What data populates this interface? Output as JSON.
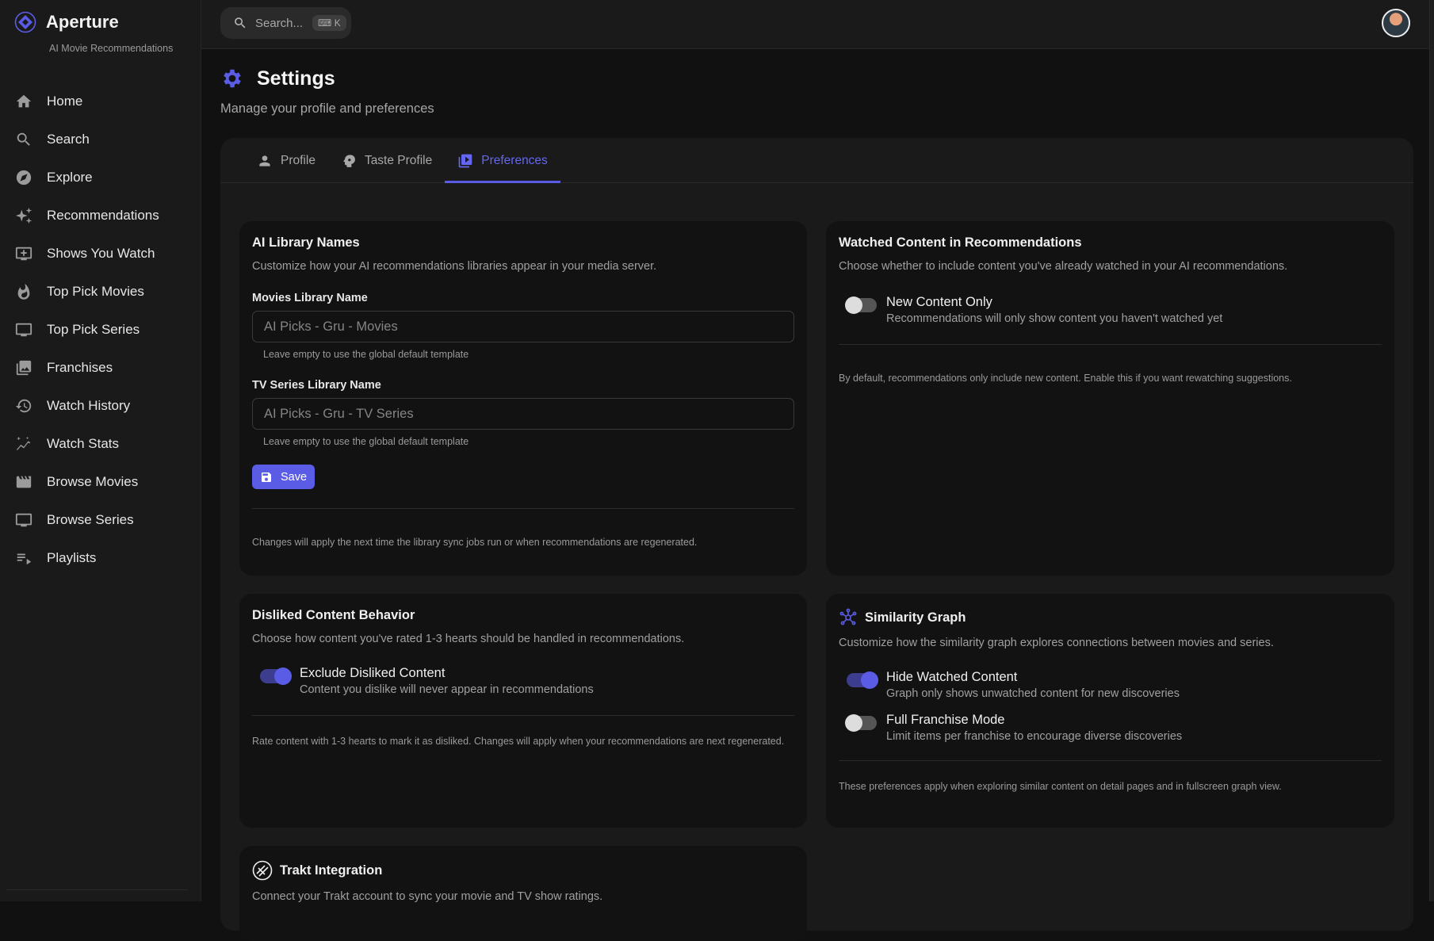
{
  "brand": {
    "name": "Aperture",
    "tagline": "AI Movie Recommendations"
  },
  "sidebar": {
    "items": [
      {
        "label": "Home",
        "icon": "home-icon"
      },
      {
        "label": "Search",
        "icon": "search-icon"
      },
      {
        "label": "Explore",
        "icon": "compass-icon"
      },
      {
        "label": "Recommendations",
        "icon": "sparkles-icon"
      },
      {
        "label": "Shows You Watch",
        "icon": "tv-add-icon"
      },
      {
        "label": "Top Pick Movies",
        "icon": "fire-icon"
      },
      {
        "label": "Top Pick Series",
        "icon": "tv-icon"
      },
      {
        "label": "Franchises",
        "icon": "photo-library-icon"
      },
      {
        "label": "Watch History",
        "icon": "history-icon"
      },
      {
        "label": "Watch Stats",
        "icon": "chart-icon"
      },
      {
        "label": "Browse Movies",
        "icon": "clapperboard-icon"
      },
      {
        "label": "Browse Series",
        "icon": "tv-icon"
      },
      {
        "label": "Playlists",
        "icon": "playlist-icon"
      }
    ]
  },
  "topbar": {
    "search_placeholder": "Search...",
    "shortcut": "K"
  },
  "page": {
    "title": "Settings",
    "subtitle": "Manage your profile and preferences"
  },
  "tabs": [
    {
      "label": "Profile"
    },
    {
      "label": "Taste Profile"
    },
    {
      "label": "Preferences",
      "active": true
    }
  ],
  "library": {
    "title": "AI Library Names",
    "desc": "Customize how your AI recommendations libraries appear in your media server.",
    "movies_label": "Movies Library Name",
    "movies_placeholder": "AI Picks - Gru - Movies",
    "series_label": "TV Series Library Name",
    "series_placeholder": "AI Picks - Gru - TV Series",
    "hint": "Leave empty to use the global default template",
    "save": "Save",
    "footer": "Changes will apply the next time the library sync jobs run or when recommendations are regenerated."
  },
  "watched": {
    "title": "Watched Content in Recommendations",
    "desc": "Choose whether to include content you've already watched in your AI recommendations.",
    "toggle_title": "New Content Only",
    "toggle_sub": "Recommendations will only show content you haven't watched yet",
    "toggle_on": false,
    "footer": "By default, recommendations only include new content. Enable this if you want rewatching suggestions."
  },
  "disliked": {
    "title": "Disliked Content Behavior",
    "desc": "Choose how content you've rated 1-3 hearts should be handled in recommendations.",
    "toggle_title": "Exclude Disliked Content",
    "toggle_sub": "Content you dislike will never appear in recommendations",
    "toggle_on": true,
    "footer": "Rate content with 1-3 hearts to mark it as disliked. Changes will apply when your recommendations are next regenerated."
  },
  "graph": {
    "title": "Similarity Graph",
    "desc": "Customize how the similarity graph explores connections between movies and series.",
    "t1_title": "Hide Watched Content",
    "t1_sub": "Graph only shows unwatched content for new discoveries",
    "t1_on": true,
    "t2_title": "Full Franchise Mode",
    "t2_sub": "Limit items per franchise to encourage diverse discoveries",
    "t2_on": false,
    "footer": "These preferences apply when exploring similar content on detail pages and in fullscreen graph view."
  },
  "trakt": {
    "title": "Trakt Integration",
    "desc": "Connect your Trakt account to sync your movie and TV show ratings."
  },
  "colors": {
    "accent": "#5b5ce6",
    "bg": "#111111",
    "sidebar": "#1a1a1a",
    "card": "#121212"
  }
}
